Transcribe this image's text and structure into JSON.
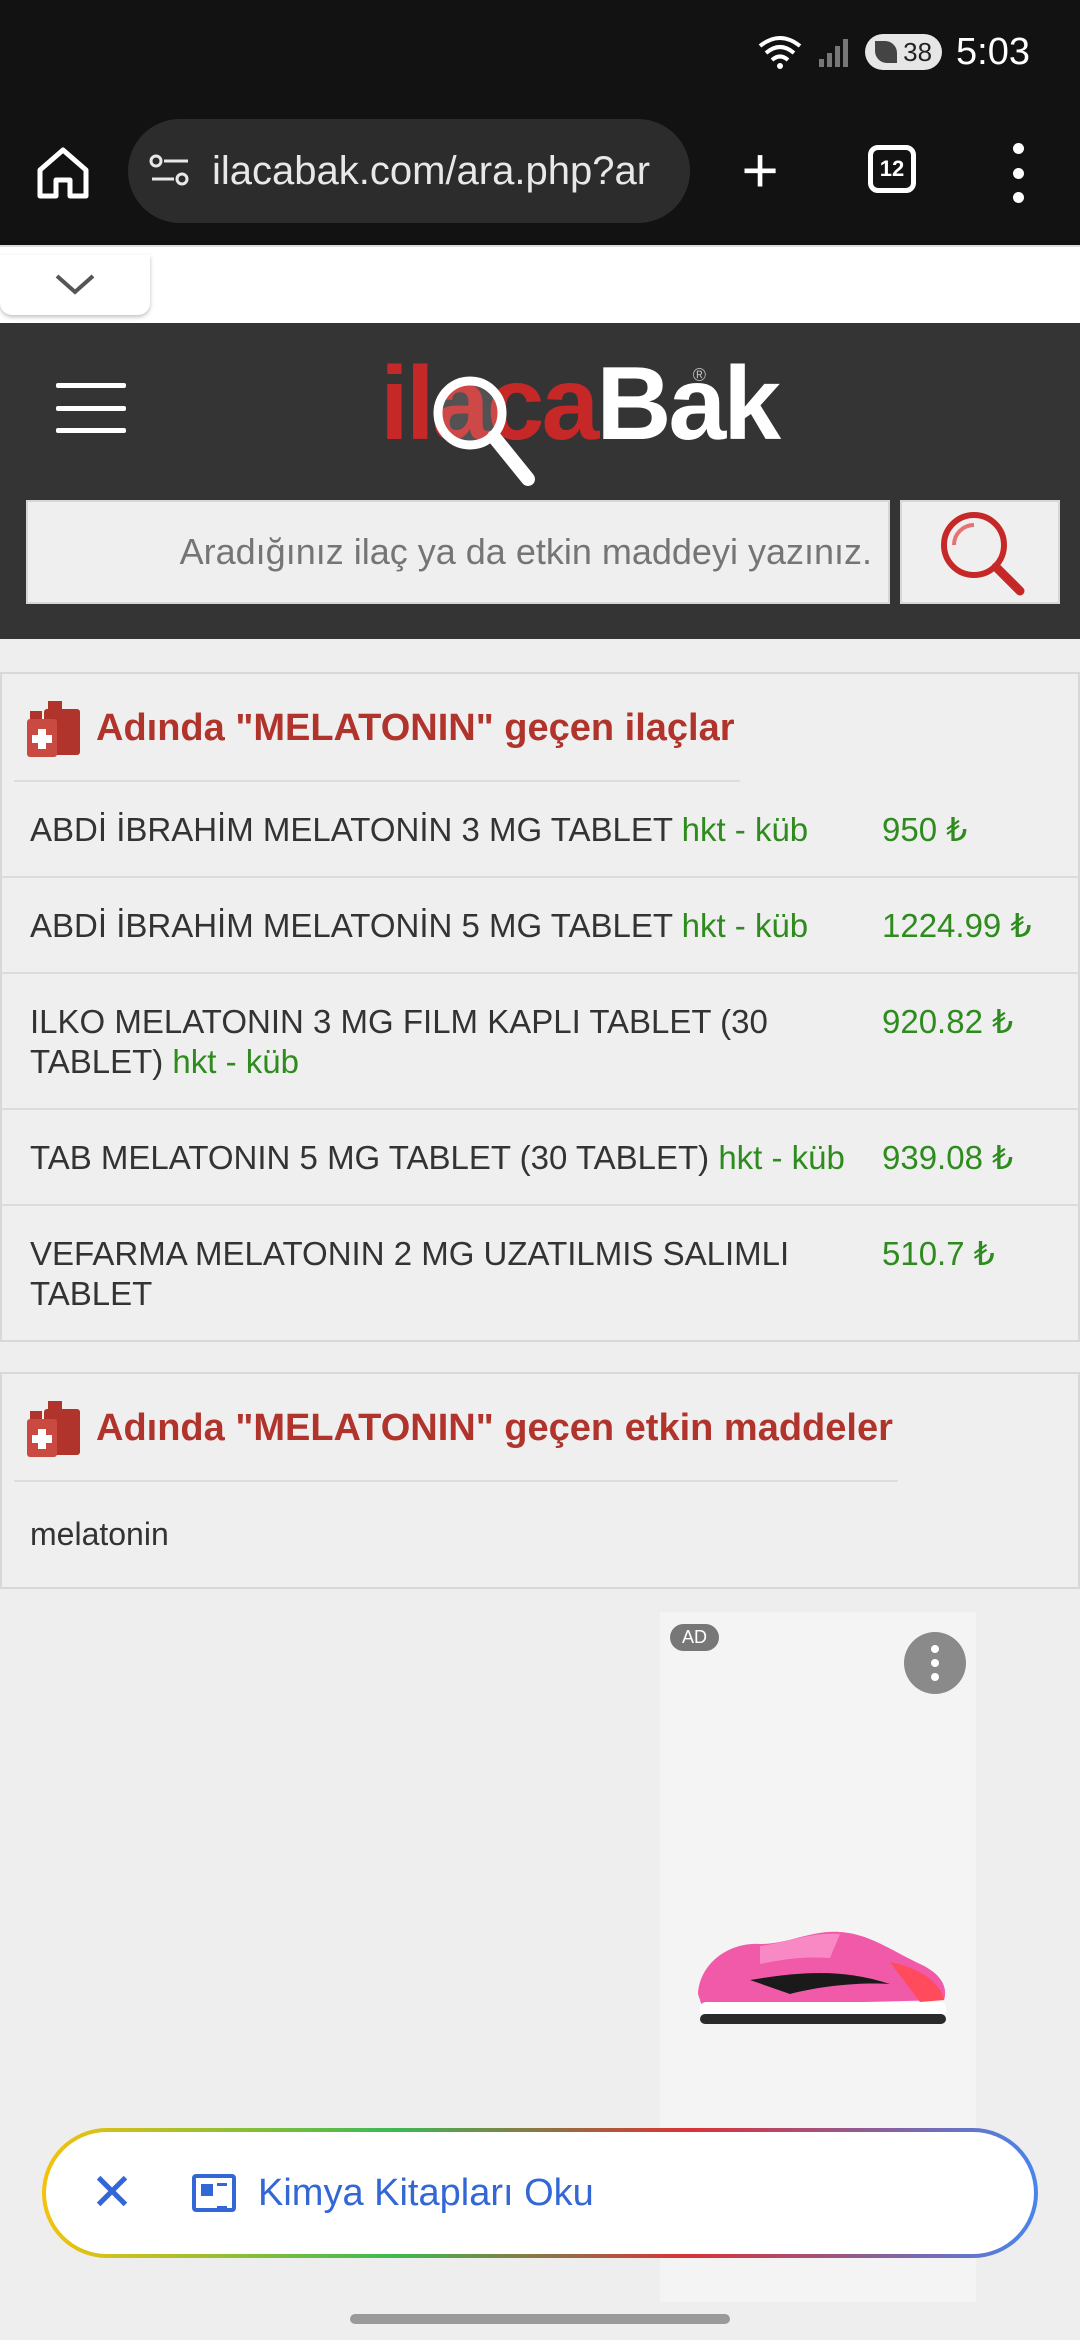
{
  "status": {
    "time": "5:03",
    "battery": "38"
  },
  "browser": {
    "url": "ilacabak.com/ara.php?ar",
    "tab_count": "12"
  },
  "site": {
    "logo_red": "ilaca",
    "logo_white": "Bak",
    "logo_reg": "®",
    "search_placeholder": "Aradığınız ilaç ya da etkin maddeyi yazınız."
  },
  "drugs_section": {
    "title": "Adında \"MELATONIN\" geçen ilaçlar",
    "rows": [
      {
        "name": "ABDİ İBRAHİM MELATONİN 3 MG TABLET",
        "tag": "hkt - küb",
        "price": "950 ₺"
      },
      {
        "name": "ABDİ İBRAHİM MELATONİN 5 MG TABLET",
        "tag": "hkt - küb",
        "price": "1224.99 ₺"
      },
      {
        "name": "ILKO MELATONIN 3 MG FILM KAPLI TABLET (30 TABLET)",
        "tag": "hkt - küb",
        "price": "920.82 ₺"
      },
      {
        "name": "TAB MELATONIN 5 MG TABLET (30 TABLET)",
        "tag": "hkt - küb",
        "price": "939.08 ₺"
      },
      {
        "name": "VEFARMA MELATONIN 2 MG UZATILMIS SALIMLI TABLET",
        "tag": "",
        "price": "510.7 ₺"
      }
    ]
  },
  "substances_section": {
    "title": "Adında \"MELATONIN\" geçen etkin maddeler",
    "items": [
      "melatonin"
    ]
  },
  "ad": {
    "badge": "AD"
  },
  "suggestion": {
    "label": "Kimya Kitapları Oku"
  }
}
